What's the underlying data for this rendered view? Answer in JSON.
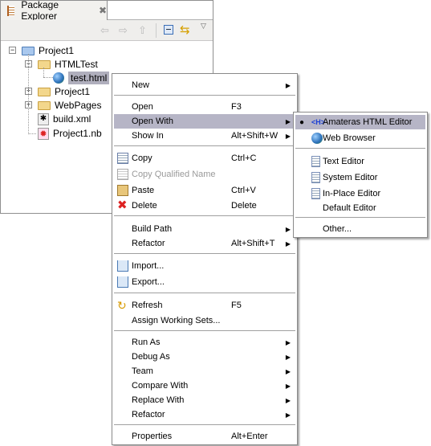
{
  "panel": {
    "tab_title": "Package Explorer",
    "close": "✖"
  },
  "tree": [
    {
      "label": "Project1",
      "type": "project",
      "expanded": true
    },
    {
      "label": "HTMLTest",
      "type": "folder",
      "expanded": true
    },
    {
      "label": "test.html",
      "type": "html",
      "selected": true
    },
    {
      "label": "Project1",
      "type": "folder",
      "expanded": false
    },
    {
      "label": "WebPages",
      "type": "folder",
      "expanded": false
    },
    {
      "label": "build.xml",
      "type": "ant"
    },
    {
      "label": "Project1.nb",
      "type": "nb"
    }
  ],
  "context_menu": [
    {
      "label": "New",
      "submenu": true
    },
    {
      "sep": true
    },
    {
      "label": "Open",
      "shortcut": "F3"
    },
    {
      "label": "Open With",
      "submenu": true,
      "highlighted": true
    },
    {
      "label": "Show In",
      "shortcut": "Alt+Shift+W",
      "submenu": true
    },
    {
      "sep": true
    },
    {
      "label": "Copy",
      "shortcut": "Ctrl+C",
      "icon": "copy-icon"
    },
    {
      "label": "Copy Qualified Name",
      "icon": "copy-qualified-icon",
      "disabled": true
    },
    {
      "label": "Paste",
      "shortcut": "Ctrl+V",
      "icon": "paste-icon"
    },
    {
      "label": "Delete",
      "shortcut": "Delete",
      "icon": "delete-icon"
    },
    {
      "sep": true
    },
    {
      "label": "Build Path",
      "submenu": true
    },
    {
      "label": "Refactor",
      "shortcut": "Alt+Shift+T",
      "submenu": true
    },
    {
      "sep": true
    },
    {
      "label": "Import...",
      "icon": "import-icon"
    },
    {
      "label": "Export...",
      "icon": "export-icon"
    },
    {
      "sep": true
    },
    {
      "label": "Refresh",
      "shortcut": "F5",
      "icon": "refresh-icon"
    },
    {
      "label": "Assign Working Sets..."
    },
    {
      "sep": true
    },
    {
      "label": "Run As",
      "submenu": true
    },
    {
      "label": "Debug As",
      "submenu": true
    },
    {
      "label": "Team",
      "submenu": true
    },
    {
      "label": "Compare With",
      "submenu": true
    },
    {
      "label": "Replace With",
      "submenu": true
    },
    {
      "label": "Refactor",
      "submenu": true
    },
    {
      "sep": true
    },
    {
      "label": "Properties",
      "shortcut": "Alt+Enter"
    }
  ],
  "open_with_menu": [
    {
      "label": "Amateras HTML Editor",
      "icon": "html-editor-icon",
      "checked": true,
      "highlighted": true
    },
    {
      "label": "Web Browser",
      "icon": "globe-icon"
    },
    {
      "sep": true
    },
    {
      "label": "Text Editor",
      "icon": "text-file-icon"
    },
    {
      "label": "System Editor",
      "icon": "text-file-icon"
    },
    {
      "label": "In-Place Editor",
      "icon": "text-file-icon"
    },
    {
      "label": "Default Editor"
    },
    {
      "sep": true
    },
    {
      "label": "Other..."
    }
  ]
}
